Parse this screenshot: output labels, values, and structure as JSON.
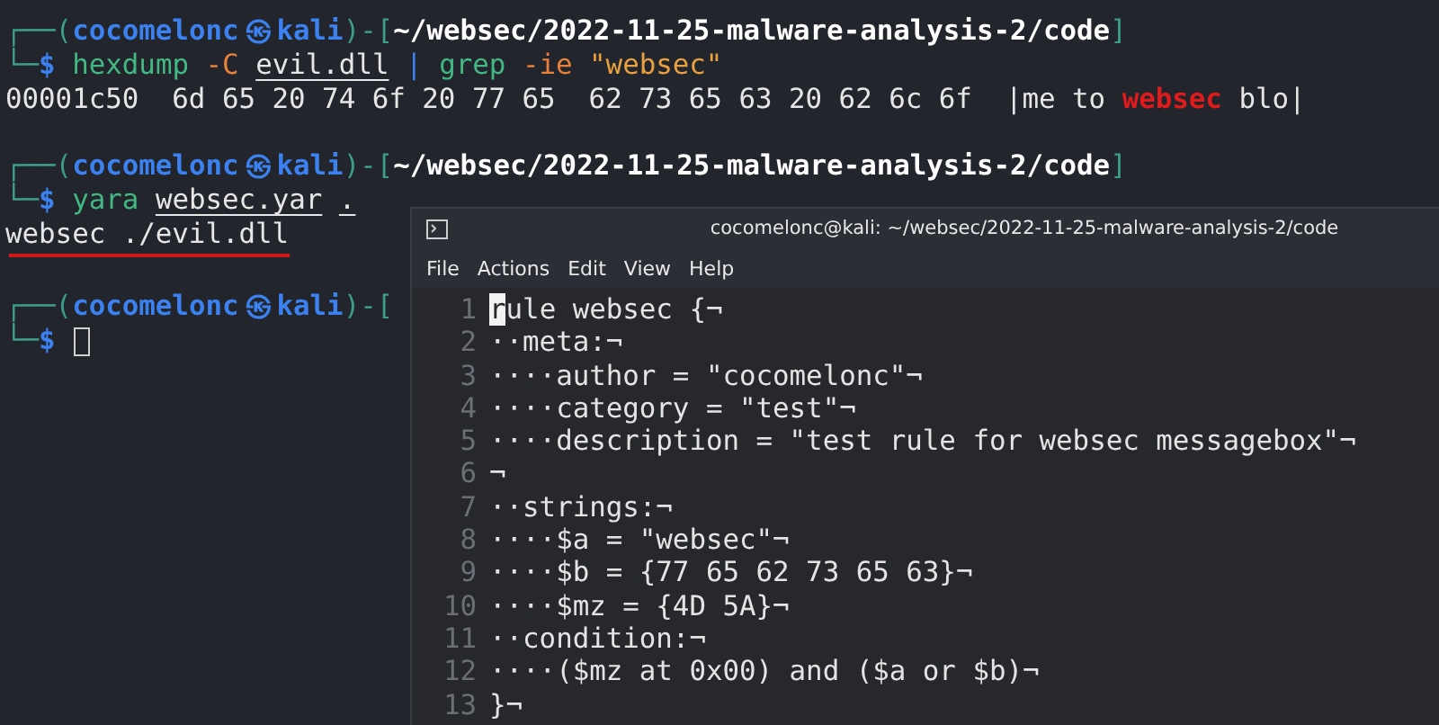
{
  "terminal": {
    "blocks": [
      {
        "prompt": {
          "open": "┌──(",
          "user": "cocomelonc",
          "at": "㉿",
          "host": "kali",
          "mid": ")-[",
          "path": "~/websec/2022-11-25-malware-analysis-2/code",
          "close": "]",
          "corner": "└─",
          "dollar": "$"
        },
        "command": [
          {
            "kind": "command",
            "text": "hexdump"
          },
          {
            "kind": "option",
            "text": "-C"
          },
          {
            "kind": "path",
            "text": "evil.dll"
          },
          {
            "kind": "pipe",
            "text": "|"
          },
          {
            "kind": "command",
            "text": "grep"
          },
          {
            "kind": "option",
            "text": "-ie"
          },
          {
            "kind": "string",
            "text": "\"websec\""
          }
        ],
        "output": [
          {
            "segments": [
              {
                "kind": "plain",
                "text": "00001c50  6d 65 20 74 6f 20 77 65  62 73 65 63 20 62 6c 6f  |me to "
              },
              {
                "kind": "match",
                "text": "websec"
              },
              {
                "kind": "plain",
                "text": " blo|"
              }
            ],
            "underlined": false
          }
        ]
      },
      {
        "prompt": {
          "open": "┌──(",
          "user": "cocomelonc",
          "at": "㉿",
          "host": "kali",
          "mid": ")-[",
          "path": "~/websec/2022-11-25-malware-analysis-2/code",
          "close": "]",
          "corner": "└─",
          "dollar": "$"
        },
        "command": [
          {
            "kind": "command",
            "text": "yara"
          },
          {
            "kind": "path",
            "text": "websec.yar"
          },
          {
            "kind": "path",
            "text": "."
          }
        ],
        "output": [
          {
            "segments": [
              {
                "kind": "plain",
                "text": "websec ./evil.dll"
              }
            ],
            "underlined": true
          }
        ]
      },
      {
        "prompt": {
          "open": "┌──(",
          "user": "cocomelonc",
          "at": "㉿",
          "host": "kali",
          "mid": ")-[",
          "corner": "└─",
          "dollar": "$"
        },
        "cursor": true
      }
    ]
  },
  "editor_window": {
    "title": "cocomelonc@kali: ~/websec/2022-11-25-malware-analysis-2/code",
    "menu": [
      "File",
      "Actions",
      "Edit",
      "View",
      "Help"
    ],
    "lines": [
      {
        "number": "1",
        "cursor": "r",
        "text": "ule websec {¬"
      },
      {
        "number": "2",
        "text": "··meta:¬"
      },
      {
        "number": "3",
        "text": "····author = \"cocomelonc\"¬"
      },
      {
        "number": "4",
        "text": "····category = \"test\"¬"
      },
      {
        "number": "5",
        "text": "····description = \"test rule for websec messagebox\"¬"
      },
      {
        "number": "6",
        "text": "¬"
      },
      {
        "number": "7",
        "text": "··strings:¬"
      },
      {
        "number": "8",
        "text": "····$a = \"websec\"¬"
      },
      {
        "number": "9",
        "text": "····$b = {77 65 62 73 65 63}¬"
      },
      {
        "number": "10",
        "text": "····$mz = {4D 5A}¬"
      },
      {
        "number": "11",
        "text": "··condition:¬"
      },
      {
        "number": "12",
        "text": "····($mz at 0x00) and ($a or $b)¬"
      },
      {
        "number": "13",
        "text": "}¬"
      }
    ]
  }
}
